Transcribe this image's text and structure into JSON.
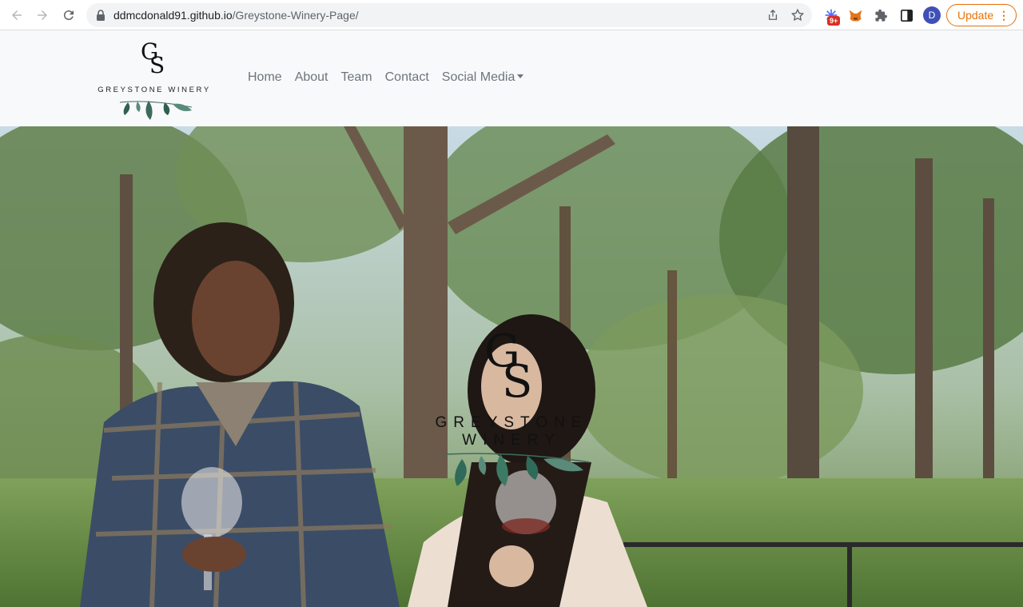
{
  "browser": {
    "url_host": "ddmcdonald91.github.io",
    "url_path": "/Greystone-Winery-Page/",
    "extension_badge": "9+",
    "profile_initial": "D",
    "update_label": "Update",
    "icons": [
      "back-arrow-icon",
      "forward-arrow-icon",
      "reload-icon",
      "lock-icon",
      "share-icon",
      "bookmark-star-icon",
      "extension-icon",
      "metamask-fox-icon",
      "puzzle-icon",
      "side-panel-icon",
      "kebab-menu-icon"
    ],
    "colors": {
      "update_accent": "#e8710a",
      "badge": "#d93025",
      "avatar": "#3f51b5"
    }
  },
  "site": {
    "brand": {
      "monogram": "GS",
      "name": "GREYSTONE WINERY"
    },
    "nav": {
      "items": [
        {
          "label": "Home"
        },
        {
          "label": "About"
        },
        {
          "label": "Team"
        },
        {
          "label": "Contact"
        },
        {
          "label": "Social Media",
          "dropdown": true
        }
      ]
    },
    "hero": {
      "monogram": "GS",
      "name": "GREYSTONE WINERY"
    },
    "colors": {
      "nav_bg": "#f8f9fa",
      "nav_link": "#6c757d",
      "leaf": "#3d6b5a"
    }
  }
}
